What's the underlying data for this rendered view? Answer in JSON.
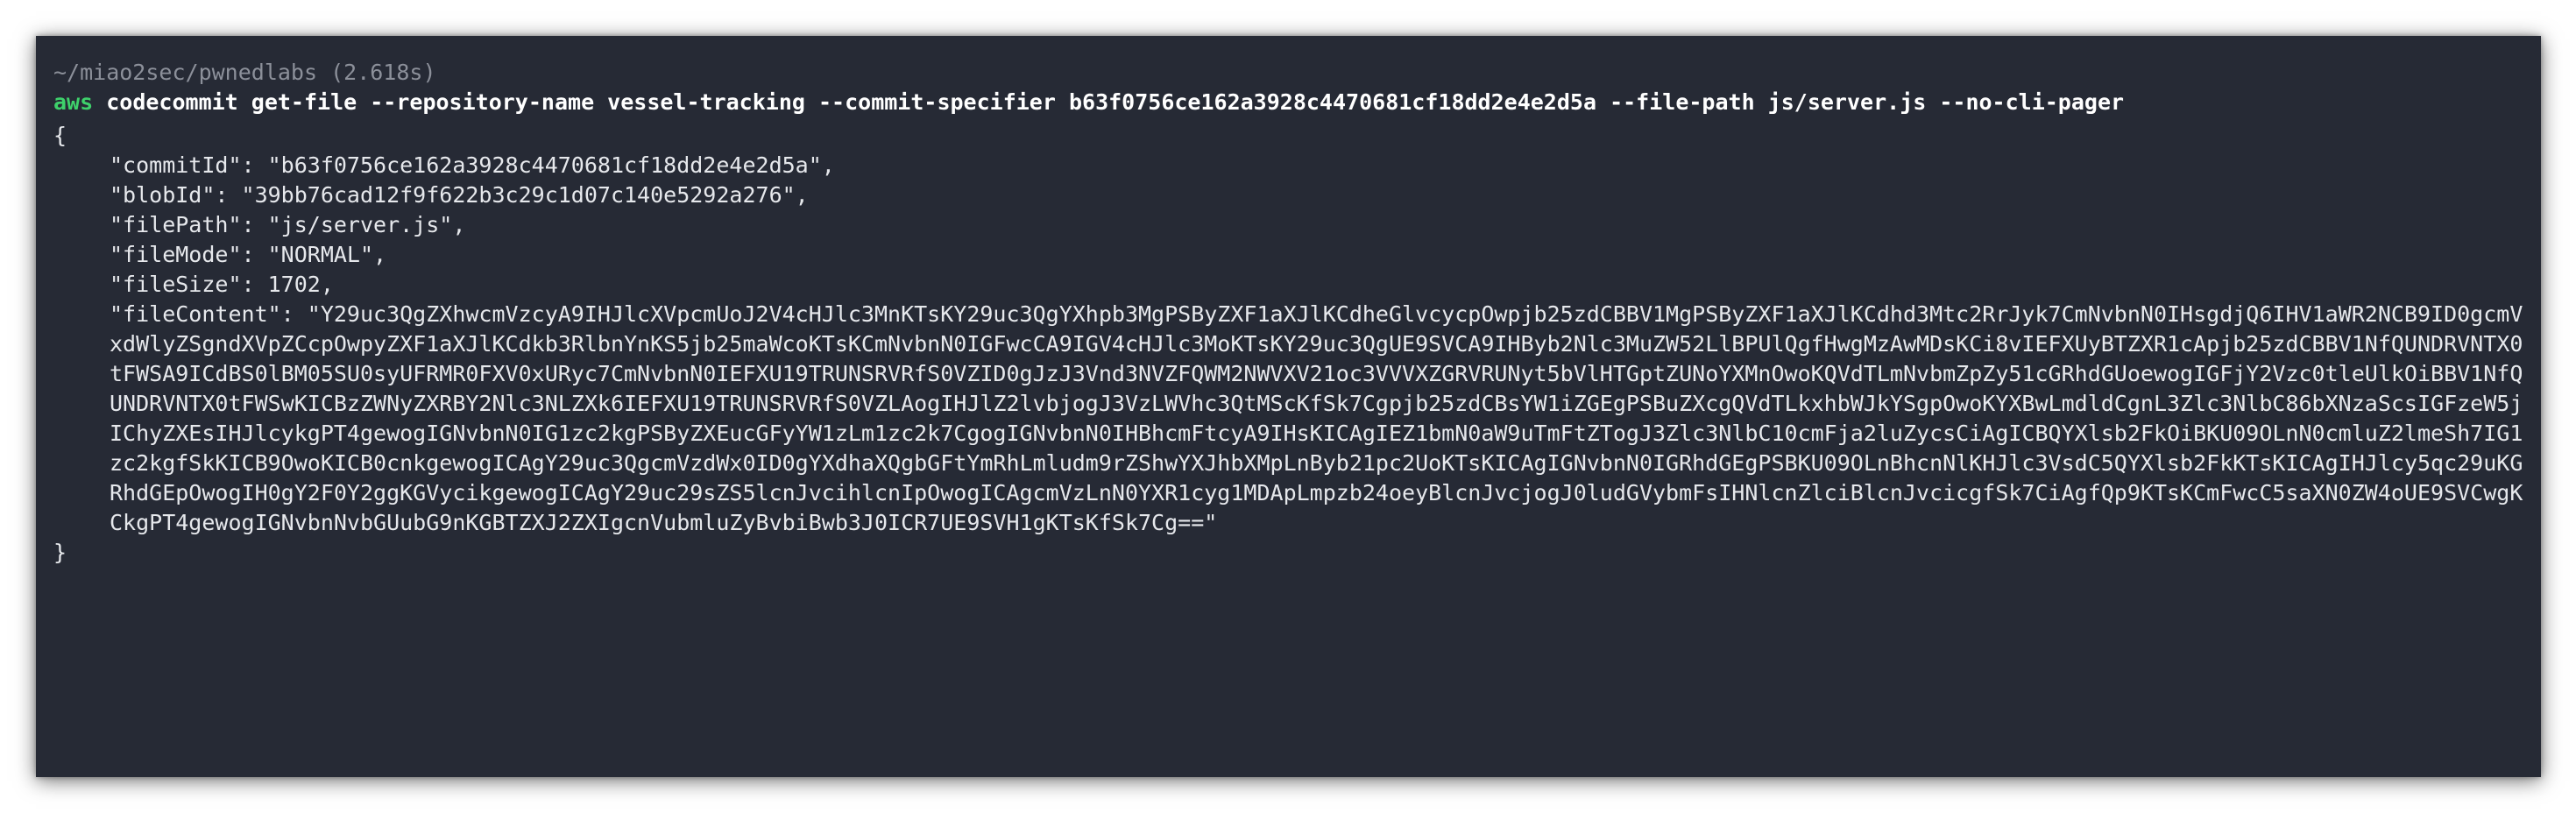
{
  "window": {
    "prompt_path": "~/miao2sec/pwnedlabs",
    "duration": "(2.618s)"
  },
  "command": {
    "exe": "aws",
    "args": "codecommit get-file --repository-name vessel-tracking --commit-specifier b63f0756ce162a3928c4470681cf18dd2e4e2d5a --file-path js/server.js --no-cli-pager"
  },
  "output": {
    "open_brace": "{",
    "close_brace": "}",
    "fields": [
      "\"commitId\": \"b63f0756ce162a3928c4470681cf18dd2e4e2d5a\",",
      "\"blobId\": \"39bb76cad12f9f622b3c29c1d07c140e5292a276\",",
      "\"filePath\": \"js/server.js\",",
      "\"fileMode\": \"NORMAL\",",
      "\"fileSize\": 1702,"
    ],
    "file_content": "\"fileContent\": \"Y29uc3QgZXhwcmVzcyA9IHJlcXVpcmUoJ2V4cHJlc3MnKTsKY29uc3QgYXhpb3MgPSByZXF1aXJlKCdheGlvcycpOwpjb25zdCBBV1MgPSByZXF1aXJlKCdhd3Mtc2RrJyk7CmNvbnN0IHsgdjQ6IHV1aWR2NCB9ID0gcmVxdWlyZSgndXVpZCcpOwpyZXF1aXJlKCdkb3RlbnYnKS5jb25maWcoKTsKCmNvbnN0IGFwcCA9IGV4cHJlc3MoKTsKY29uc3QgUE9SVCA9IHByb2Nlc3MuZW52LlBPUlQgfHwgMzAwMDsKCi8vIEFXUyBTZXR1cApjb25zdCBBV1NfQUNDRVNTX0tFWSA9ICdBS0lBM05SU0syUFRMR0FXV0xURyc7CmNvbnN0IEFXU19TRUNSRVRfS0VZID0gJzJ3Vnd3NVZFQWM2NWVXV21oc3VVVXZGRVRUNyt5bVlHTGptZUNoYXMnOwoKQVdTLmNvbmZpZy51cGRhdGUoewogIGFjY2Vzc0tleUlkOiBBV1NfQUNDRVNTX0tFWSwKICBzZWNyZXRBY2Nlc3NLZXk6IEFXU19TRUNSRVRfS0VZLAogIHJlZ2lvbjogJ3VzLWVhc3QtMScKfSk7Cgpjb25zdCBsYW1iZGEgPSBuZXcgQVdTLkxhbWJkYSgpOwoKYXBwLmdldCgnL3Zlc3NlbC86bXNzaScsIGFzeW5jIChyZXEsIHJlcykgPT4gewogIGNvbnN0IG1zc2kgPSByZXEucGFyYW1zLm1zc2k7CgogIGNvbnN0IHBhcmFtcyA9IHsKICAgIEZ1bmN0aW9uTmFtZTogJ3Zlc3NlbC10cmFja2luZycsCiAgICBQYXlsb2FkOiBKU09OLnN0cmluZ2lmeSh7IG1zc2kgfSkKICB9OwoKICB0cnkgewogICAgY29uc3QgcmVzdWx0ID0gYXdhaXQgbGFtYmRhLmludm9rZShwYXJhbXMpLnByb21pc2UoKTsKICAgIGNvbnN0IGRhdGEgPSBKU09OLnBhcnNlKHJlc3VsdC5QYXlsb2FkKTsKICAgIHJlcy5qc29uKGRhdGEpOwogIH0gY2F0Y2ggKGVycikgewogICAgY29uc29sZS5lcnJvcihlcnIpOwogICAgcmVzLnN0YXR1cyg1MDApLmpzb24oeyBlcnJvcjogJ0ludGVybmFsIHNlcnZlciBlcnJvcicgfSk7CiAgfQp9KTsKCmFwcC5saXN0ZW4oUE9SVCwgKCkgPT4gewogIGNvbnNvbGUubG9nKGBTZXJ2ZXIgcnVubmluZyBvbiBwb3J0ICR7UE9SVH1gKTsKfSk7Cg==\""
  },
  "colors": {
    "terminal_bg": "#262a35",
    "command_green": "#3ed16b",
    "prompt_gray": "#8c909a"
  }
}
